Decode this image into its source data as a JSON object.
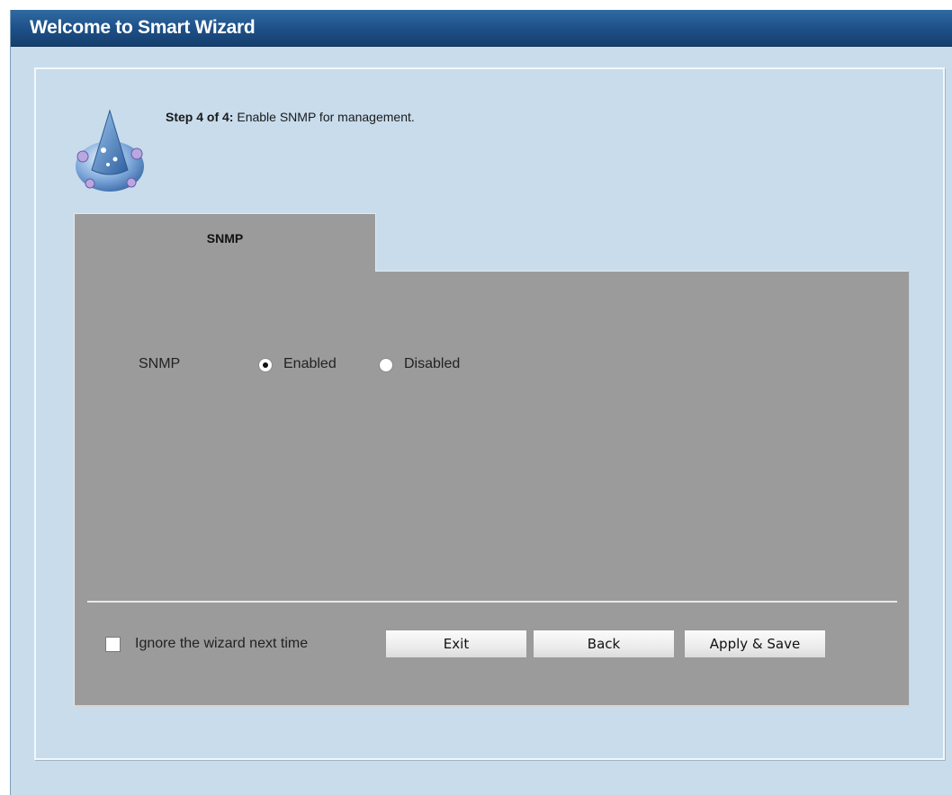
{
  "window": {
    "title": "Welcome to Smart Wizard"
  },
  "step": {
    "prefix": "Step 4 of 4:",
    "description": " Enable SNMP for management."
  },
  "tab": {
    "label": "SNMP"
  },
  "snmp": {
    "label": "SNMP",
    "options": [
      {
        "label": "Enabled",
        "selected": true
      },
      {
        "label": "Disabled",
        "selected": false
      }
    ]
  },
  "footer": {
    "ignore_label": "Ignore the wizard next time",
    "ignore_checked": false,
    "buttons": {
      "exit": "Exit",
      "back": "Back",
      "apply": "Apply & Save"
    }
  },
  "colors": {
    "title_bar": "#1d4f86",
    "background": "#c8dcec",
    "panel": "#9b9b9b"
  }
}
